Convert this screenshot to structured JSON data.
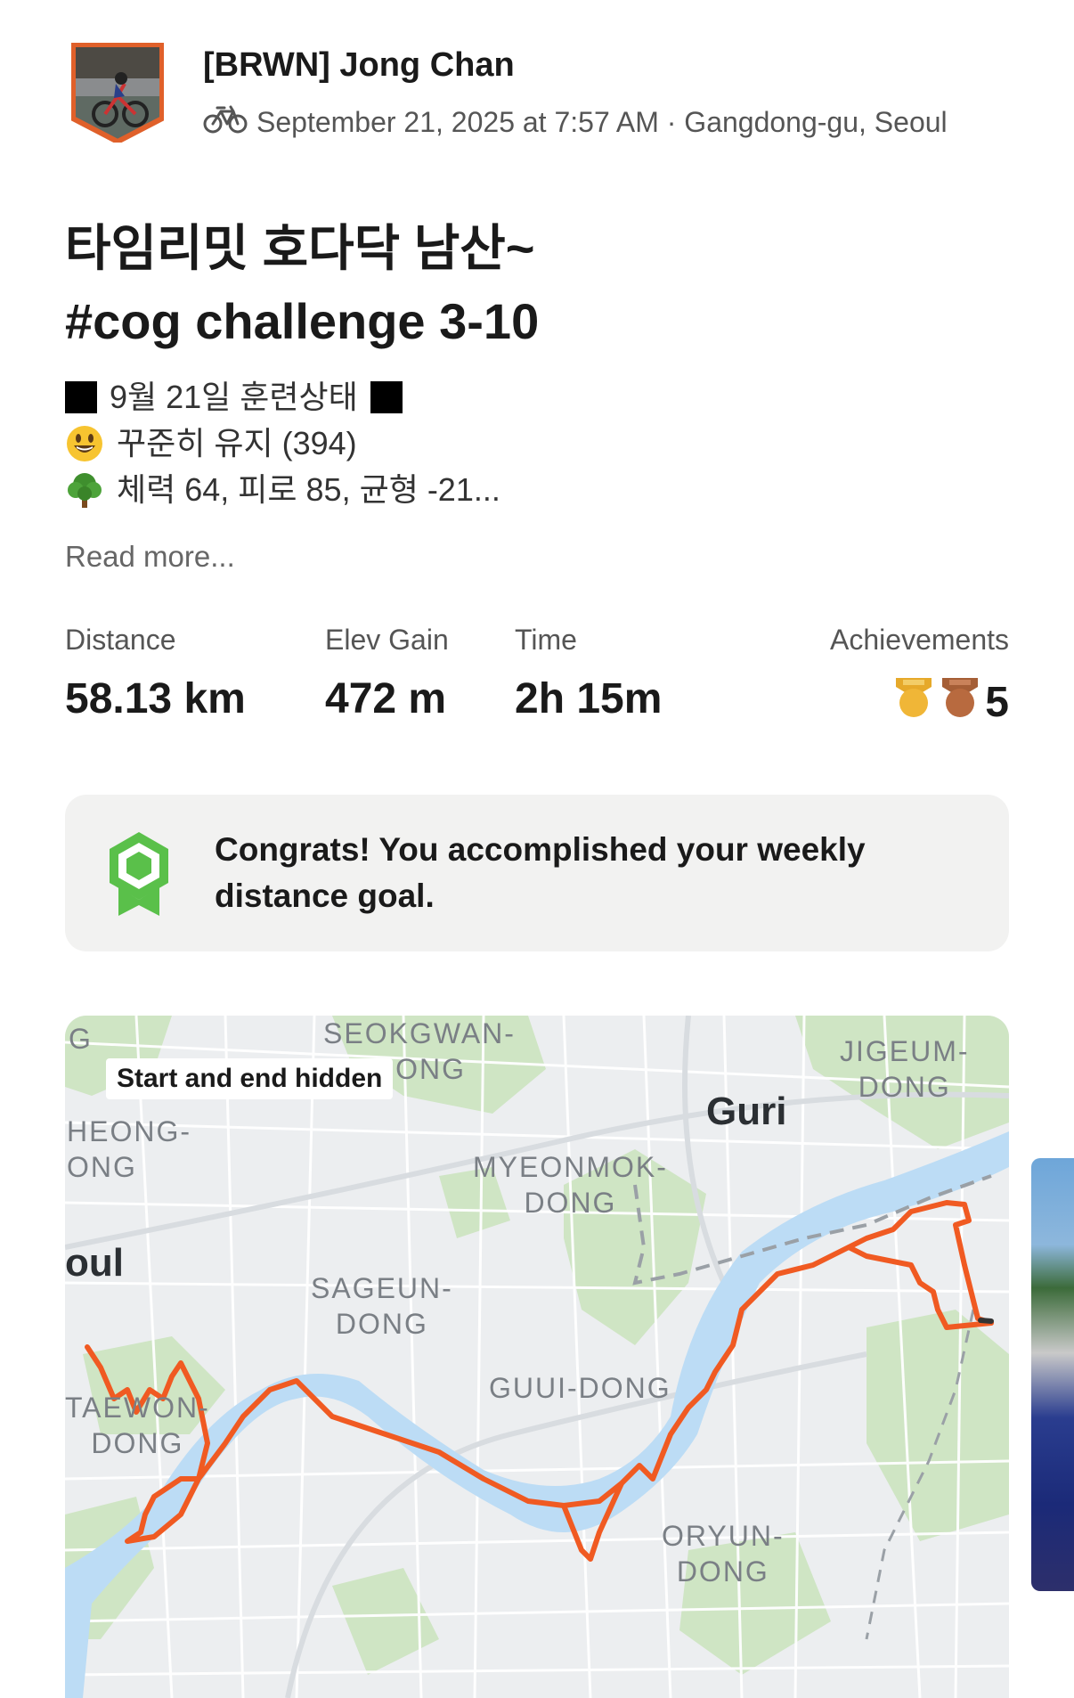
{
  "header": {
    "athlete_name": "[BRWN] Jong Chan",
    "activity_icon": "bike-icon",
    "meta": "September 21, 2025 at 7:57 AM · Gangdong-gu, Seoul"
  },
  "activity": {
    "title_line1": "타임리밋 호다닥 남산~",
    "title_line2": "#cog challenge 3-10",
    "description": {
      "line1": "9월 21일 훈련상태",
      "line2": "꾸준히 유지 (394)",
      "line3": "체력 64, 피로 85, 균형 -21..."
    },
    "read_more": "Read more..."
  },
  "stats": {
    "distance": {
      "label": "Distance",
      "value": "58.13 km"
    },
    "elev_gain": {
      "label": "Elev Gain",
      "value": "472 m"
    },
    "time": {
      "label": "Time",
      "value": "2h 15m"
    },
    "achievements": {
      "label": "Achievements",
      "count": "5",
      "medals": [
        "gold-medal-icon",
        "bronze-medal-icon"
      ]
    }
  },
  "goal_banner": {
    "text": "Congrats! You accomplished your weekly distance goal.",
    "icon": "goal-badge-icon",
    "accent": "#5ac04a"
  },
  "map": {
    "badge": "Start and end hidden",
    "route_color": "#f05a22",
    "river_color": "#bcdcf5",
    "labels": {
      "seokgwan": "SEOKGWAN-\nDONG",
      "g": "G",
      "heong": "HEONG-\nONG",
      "oul": "oul",
      "guri": "Guri",
      "jigeum": "JIGEUM-\nDONG",
      "myeonmok": "MYEONMOK-\nDONG",
      "sageun": "SAGEUN-\nDONG",
      "guui": "GUUI-DONG",
      "taewon": "TAEWON-\nDONG",
      "oryun": "ORYUN-\nDONG"
    }
  }
}
